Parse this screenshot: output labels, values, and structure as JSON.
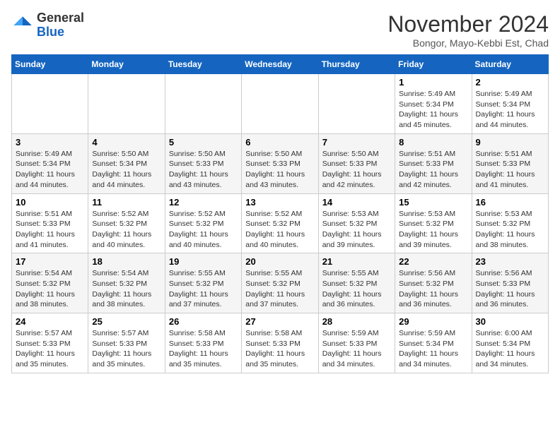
{
  "header": {
    "logo_general": "General",
    "logo_blue": "Blue",
    "month_title": "November 2024",
    "location": "Bongor, Mayo-Kebbi Est, Chad"
  },
  "weekdays": [
    "Sunday",
    "Monday",
    "Tuesday",
    "Wednesday",
    "Thursday",
    "Friday",
    "Saturday"
  ],
  "weeks": [
    [
      {
        "day": "",
        "info": ""
      },
      {
        "day": "",
        "info": ""
      },
      {
        "day": "",
        "info": ""
      },
      {
        "day": "",
        "info": ""
      },
      {
        "day": "",
        "info": ""
      },
      {
        "day": "1",
        "info": "Sunrise: 5:49 AM\nSunset: 5:34 PM\nDaylight: 11 hours and 45 minutes."
      },
      {
        "day": "2",
        "info": "Sunrise: 5:49 AM\nSunset: 5:34 PM\nDaylight: 11 hours and 44 minutes."
      }
    ],
    [
      {
        "day": "3",
        "info": "Sunrise: 5:49 AM\nSunset: 5:34 PM\nDaylight: 11 hours and 44 minutes."
      },
      {
        "day": "4",
        "info": "Sunrise: 5:50 AM\nSunset: 5:34 PM\nDaylight: 11 hours and 44 minutes."
      },
      {
        "day": "5",
        "info": "Sunrise: 5:50 AM\nSunset: 5:33 PM\nDaylight: 11 hours and 43 minutes."
      },
      {
        "day": "6",
        "info": "Sunrise: 5:50 AM\nSunset: 5:33 PM\nDaylight: 11 hours and 43 minutes."
      },
      {
        "day": "7",
        "info": "Sunrise: 5:50 AM\nSunset: 5:33 PM\nDaylight: 11 hours and 42 minutes."
      },
      {
        "day": "8",
        "info": "Sunrise: 5:51 AM\nSunset: 5:33 PM\nDaylight: 11 hours and 42 minutes."
      },
      {
        "day": "9",
        "info": "Sunrise: 5:51 AM\nSunset: 5:33 PM\nDaylight: 11 hours and 41 minutes."
      }
    ],
    [
      {
        "day": "10",
        "info": "Sunrise: 5:51 AM\nSunset: 5:33 PM\nDaylight: 11 hours and 41 minutes."
      },
      {
        "day": "11",
        "info": "Sunrise: 5:52 AM\nSunset: 5:32 PM\nDaylight: 11 hours and 40 minutes."
      },
      {
        "day": "12",
        "info": "Sunrise: 5:52 AM\nSunset: 5:32 PM\nDaylight: 11 hours and 40 minutes."
      },
      {
        "day": "13",
        "info": "Sunrise: 5:52 AM\nSunset: 5:32 PM\nDaylight: 11 hours and 40 minutes."
      },
      {
        "day": "14",
        "info": "Sunrise: 5:53 AM\nSunset: 5:32 PM\nDaylight: 11 hours and 39 minutes."
      },
      {
        "day": "15",
        "info": "Sunrise: 5:53 AM\nSunset: 5:32 PM\nDaylight: 11 hours and 39 minutes."
      },
      {
        "day": "16",
        "info": "Sunrise: 5:53 AM\nSunset: 5:32 PM\nDaylight: 11 hours and 38 minutes."
      }
    ],
    [
      {
        "day": "17",
        "info": "Sunrise: 5:54 AM\nSunset: 5:32 PM\nDaylight: 11 hours and 38 minutes."
      },
      {
        "day": "18",
        "info": "Sunrise: 5:54 AM\nSunset: 5:32 PM\nDaylight: 11 hours and 38 minutes."
      },
      {
        "day": "19",
        "info": "Sunrise: 5:55 AM\nSunset: 5:32 PM\nDaylight: 11 hours and 37 minutes."
      },
      {
        "day": "20",
        "info": "Sunrise: 5:55 AM\nSunset: 5:32 PM\nDaylight: 11 hours and 37 minutes."
      },
      {
        "day": "21",
        "info": "Sunrise: 5:55 AM\nSunset: 5:32 PM\nDaylight: 11 hours and 36 minutes."
      },
      {
        "day": "22",
        "info": "Sunrise: 5:56 AM\nSunset: 5:32 PM\nDaylight: 11 hours and 36 minutes."
      },
      {
        "day": "23",
        "info": "Sunrise: 5:56 AM\nSunset: 5:33 PM\nDaylight: 11 hours and 36 minutes."
      }
    ],
    [
      {
        "day": "24",
        "info": "Sunrise: 5:57 AM\nSunset: 5:33 PM\nDaylight: 11 hours and 35 minutes."
      },
      {
        "day": "25",
        "info": "Sunrise: 5:57 AM\nSunset: 5:33 PM\nDaylight: 11 hours and 35 minutes."
      },
      {
        "day": "26",
        "info": "Sunrise: 5:58 AM\nSunset: 5:33 PM\nDaylight: 11 hours and 35 minutes."
      },
      {
        "day": "27",
        "info": "Sunrise: 5:58 AM\nSunset: 5:33 PM\nDaylight: 11 hours and 35 minutes."
      },
      {
        "day": "28",
        "info": "Sunrise: 5:59 AM\nSunset: 5:33 PM\nDaylight: 11 hours and 34 minutes."
      },
      {
        "day": "29",
        "info": "Sunrise: 5:59 AM\nSunset: 5:34 PM\nDaylight: 11 hours and 34 minutes."
      },
      {
        "day": "30",
        "info": "Sunrise: 6:00 AM\nSunset: 5:34 PM\nDaylight: 11 hours and 34 minutes."
      }
    ]
  ]
}
